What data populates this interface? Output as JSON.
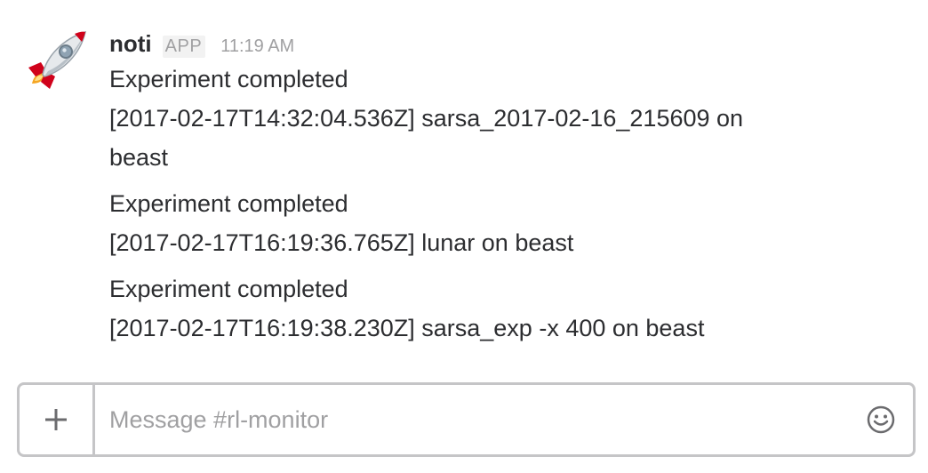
{
  "message": {
    "sender": "noti",
    "badge": "APP",
    "time": "11:19 AM",
    "avatar_icon": "rocket-icon",
    "entries": [
      {
        "title": "Experiment completed",
        "lines": [
          "[2017-02-17T14:32:04.536Z] sarsa_2017-02-16_215609 on",
          "beast"
        ]
      },
      {
        "title": "Experiment completed",
        "lines": [
          "[2017-02-17T16:19:36.765Z] lunar on beast"
        ]
      },
      {
        "title": "Experiment completed",
        "lines": [
          "[2017-02-17T16:19:38.230Z] sarsa_exp -x 400 on beast"
        ]
      }
    ]
  },
  "composer": {
    "placeholder": "Message #rl-monitor",
    "value": "",
    "attach_icon": "plus-icon",
    "emoji_icon": "smiley-icon"
  },
  "colors": {
    "text": "#2c2d30",
    "muted": "#a0a0a2",
    "border": "#c5c5c7"
  }
}
